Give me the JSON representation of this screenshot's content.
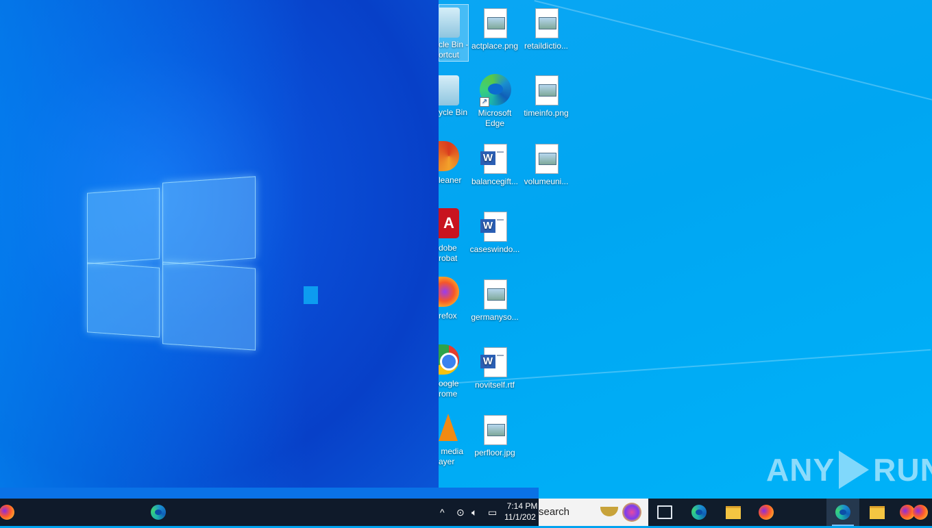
{
  "desktop_icons": {
    "recycle_shortcut": "cle Bin -\nortcut",
    "recycle_bin": "ycle Bin",
    "ccleaner": "leaner",
    "adobe": "dobe\nrobat",
    "firefox": "refox",
    "chrome": "oogle\nrome",
    "vlc": " media\nayer",
    "actplace": "actplace.png",
    "edge": "Microsoft\nEdge",
    "balancegift": "balancegift...",
    "caseswindo": "caseswindo...",
    "germanyso": "germanyso...",
    "novitself": "novitself.rtf",
    "perfloor": "perfloor.jpg",
    "retaildictio": "retaildictio...",
    "timeinfo": "timeinfo.png",
    "volumeuni": "volumeuni..."
  },
  "watermark": {
    "left": "ANY",
    "right": "RUN"
  },
  "taskbar": {
    "search_text": "search",
    "time": "7:14 PM",
    "date": "11/1/202",
    "tray_chevron": "^",
    "icons": [
      "edge-icon",
      "firefox-icon",
      "file-explorer-icon",
      "task-view-icon"
    ]
  },
  "colors": {
    "desktop_right": "#00a6f2",
    "desktop_left": "#0a4fd8",
    "taskbar": "#101c2b"
  }
}
